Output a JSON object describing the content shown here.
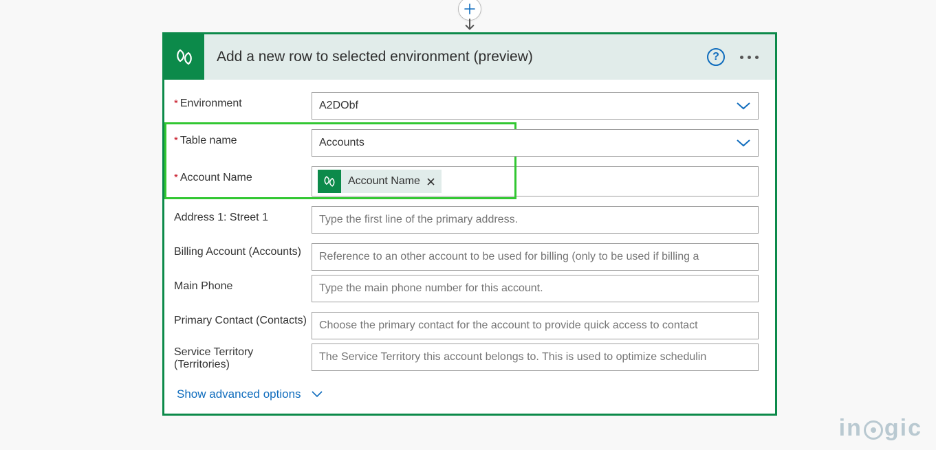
{
  "header": {
    "title": "Add a new row to selected environment (preview)"
  },
  "fields": {
    "environment": {
      "label": "Environment",
      "value": "A2DObf",
      "required": true
    },
    "table_name": {
      "label": "Table name",
      "value": "Accounts",
      "required": true
    },
    "account_name": {
      "label": "Account Name",
      "token": "Account Name",
      "required": true
    },
    "address1_street1": {
      "label": "Address 1: Street 1",
      "placeholder": "Type the first line of the primary address."
    },
    "billing_account": {
      "label": "Billing Account (Accounts)",
      "placeholder": "Reference to an other account to be used for billing (only to be used if billing a"
    },
    "main_phone": {
      "label": "Main Phone",
      "placeholder": "Type the main phone number for this account."
    },
    "primary_contact": {
      "label": "Primary Contact (Contacts)",
      "placeholder": "Choose the primary contact for the account to provide quick access to contact"
    },
    "service_territory": {
      "label": "Service Territory (Territories)",
      "placeholder": "The Service Territory this account belongs to. This is used to optimize schedulin"
    }
  },
  "footer": {
    "advanced": "Show advanced options"
  },
  "watermark": {
    "a": "in",
    "b": "gic"
  }
}
